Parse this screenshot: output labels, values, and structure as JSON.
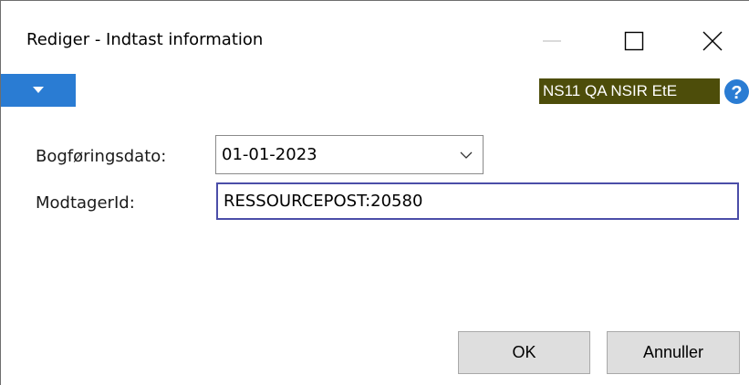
{
  "window": {
    "title": "Rediger - Indtast information",
    "controls": [
      "minimize-icon",
      "maximize-icon",
      "close-icon"
    ]
  },
  "ribbon": {
    "menu_icon": "caret-down-icon",
    "accent_color": "#2a7cd3",
    "company": "NS11 QA NSIR EtE",
    "company_bg": "#4d4d0a",
    "help_icon": "question-circle-icon"
  },
  "form": {
    "date_label": "Bogføringsdato:",
    "date_value": "01-01-2023",
    "recipient_label": "ModtagerId:",
    "recipient_value": "RESSOURCEPOST:20580"
  },
  "buttons": {
    "ok": "OK",
    "cancel": "Annuller"
  }
}
